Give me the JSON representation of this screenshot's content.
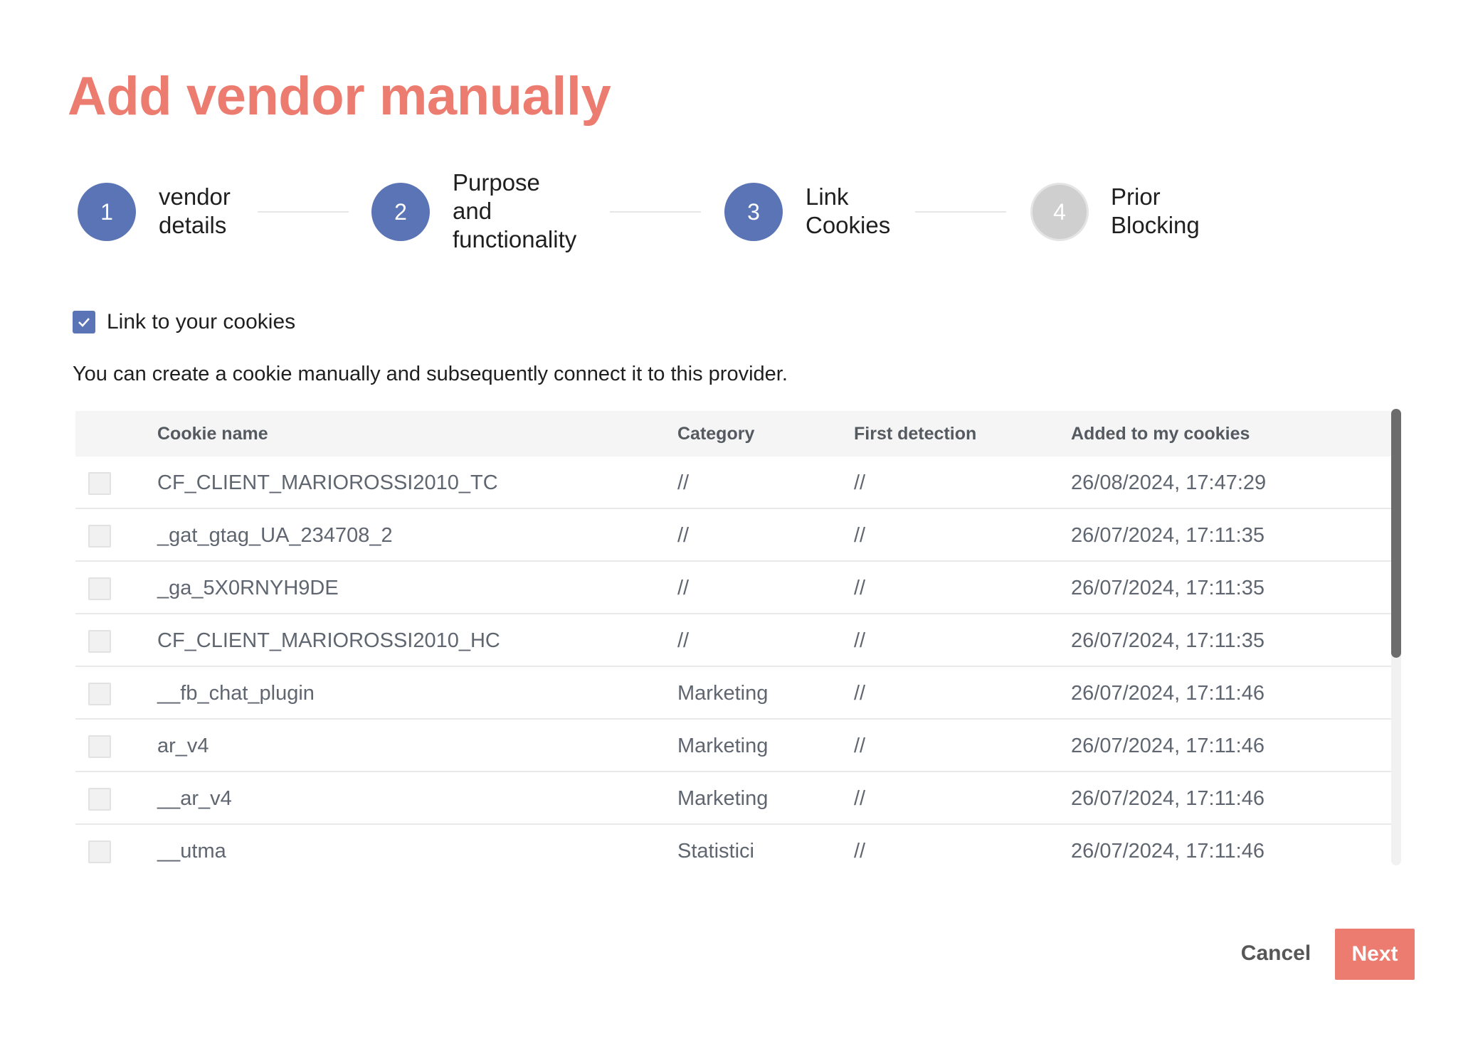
{
  "page": {
    "title": "Add vendor manually"
  },
  "stepper": {
    "steps": [
      {
        "number": "1",
        "label_line1": "vendor",
        "label_line2": "details",
        "state": "done"
      },
      {
        "number": "2",
        "label_line1": "Purpose",
        "label_line2": "and",
        "label_line3": "functionality",
        "state": "done"
      },
      {
        "number": "3",
        "label_line1": "Link",
        "label_line2": "Cookies",
        "state": "active"
      },
      {
        "number": "4",
        "label_line1": "Prior",
        "label_line2": "Blocking",
        "state": "inactive"
      }
    ]
  },
  "link_option": {
    "label": "Link to your cookies",
    "checked": true
  },
  "description": "You can create a cookie manually and subsequently connect it to this provider.",
  "table": {
    "columns": {
      "name": "Cookie name",
      "category": "Category",
      "first_detection": "First detection",
      "added": "Added to my cookies"
    },
    "rows": [
      {
        "name": "CF_CLIENT_MARIOROSSI2010_TC",
        "category": "//",
        "first_detection": "//",
        "added": "26/08/2024, 17:47:29",
        "checked": false
      },
      {
        "name": "_gat_gtag_UA_234708_2",
        "category": "//",
        "first_detection": "//",
        "added": "26/07/2024, 17:11:35",
        "checked": false
      },
      {
        "name": "_ga_5X0RNYH9DE",
        "category": "//",
        "first_detection": "//",
        "added": "26/07/2024, 17:11:35",
        "checked": false
      },
      {
        "name": "CF_CLIENT_MARIOROSSI2010_HC",
        "category": "//",
        "first_detection": "//",
        "added": "26/07/2024, 17:11:35",
        "checked": false
      },
      {
        "name": "__fb_chat_plugin",
        "category": "Marketing",
        "first_detection": "//",
        "added": "26/07/2024, 17:11:46",
        "checked": false
      },
      {
        "name": "ar_v4",
        "category": "Marketing",
        "first_detection": "//",
        "added": "26/07/2024, 17:11:46",
        "checked": false
      },
      {
        "name": "__ar_v4",
        "category": "Marketing",
        "first_detection": "//",
        "added": "26/07/2024, 17:11:46",
        "checked": false
      },
      {
        "name": "__utma",
        "category": "Statistici",
        "first_detection": "//",
        "added": "26/07/2024, 17:11:46",
        "checked": false
      }
    ]
  },
  "actions": {
    "cancel_label": "Cancel",
    "next_label": "Next"
  },
  "colors": {
    "accent": "#ec7b70",
    "step_active": "#5b74b5",
    "step_inactive": "#cfcfcf"
  },
  "icons": {
    "link_checkbox": "checkmark-icon"
  }
}
